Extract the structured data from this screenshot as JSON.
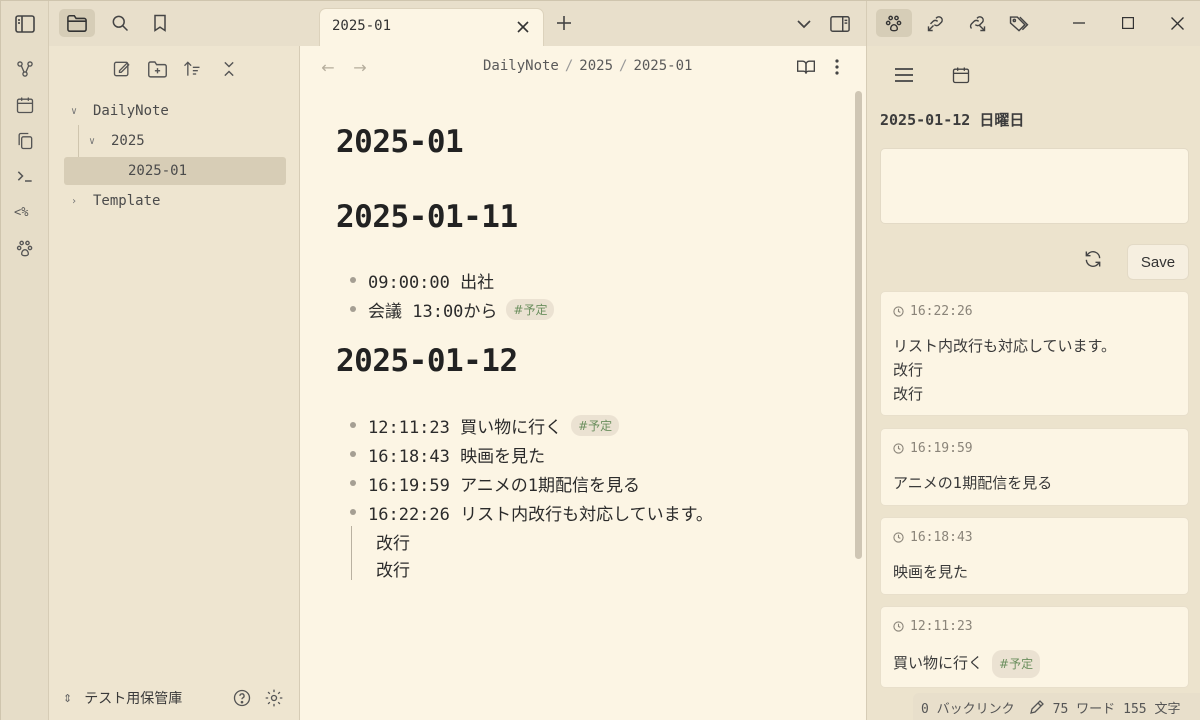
{
  "explorer": {
    "tree": [
      {
        "label": "DailyNote"
      },
      {
        "label": "2025"
      },
      {
        "label": "2025-01"
      },
      {
        "label": "Template"
      }
    ],
    "vault_name": "テスト用保管庫"
  },
  "editor": {
    "tab_title": "2025-01",
    "breadcrumb": [
      "DailyNote",
      "2025",
      "2025-01"
    ],
    "headings": [
      "2025-01",
      "2025-01-11",
      "2025-01-12"
    ],
    "section1_items": [
      {
        "text": "09:00:00 出社",
        "tag": ""
      },
      {
        "text": "会議 13:00から",
        "tag": "#予定"
      }
    ],
    "section2_items": [
      {
        "text": "12:11:23 買い物に行く",
        "tag": "#予定"
      },
      {
        "text": "16:18:43 映画を見た",
        "tag": ""
      },
      {
        "text": "16:19:59 アニメの1期配信を見る",
        "tag": ""
      },
      {
        "text": "16:22:26 リスト内改行も対応しています。",
        "tag": ""
      }
    ],
    "continuation_lines": [
      "改行",
      "改行"
    ]
  },
  "sidebar": {
    "date_label": "2025-01-12 日曜日",
    "save_label": "Save",
    "memos": [
      {
        "time": "16:22:26",
        "lines": [
          "リスト内改行も対応しています。",
          "改行",
          "改行"
        ],
        "tag": ""
      },
      {
        "time": "16:19:59",
        "lines": [
          "アニメの1期配信を見る"
        ],
        "tag": ""
      },
      {
        "time": "16:18:43",
        "lines": [
          "映画を見た"
        ],
        "tag": ""
      },
      {
        "time": "12:11:23",
        "lines": [
          "買い物に行く"
        ],
        "tag": "#予定"
      }
    ]
  },
  "status": {
    "backlinks": "0 バックリンク",
    "words": "75 ワード",
    "chars": "155 文字"
  },
  "colors": {
    "background": "#fcf5e4",
    "chrome": "#e8dfcb",
    "tag_text": "#6b8f5e"
  }
}
